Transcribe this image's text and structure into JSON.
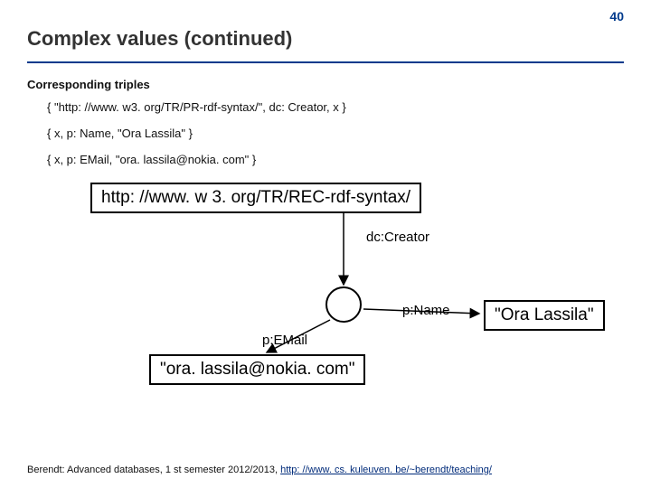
{
  "page_number": "40",
  "title": "Complex values (continued)",
  "subhead": "Corresponding triples",
  "triples": {
    "t1": "{ \"http: //www. w3. org/TR/PR-rdf-syntax/\", dc: Creator, x }",
    "t2": "{ x, p: Name, \"Ora Lassila\" }",
    "t3": "{ x, p: EMail, \"ora. lassila@nokia. com\" }"
  },
  "diagram": {
    "uri": "http: //www. w 3. org/TR/REC-rdf-syntax/",
    "creator_label": "dc:Creator",
    "name_label": "p:Name",
    "email_label": "p:EMail",
    "name_value": "\"Ora Lassila\"",
    "email_value": "\"ora. lassila@nokia. com\""
  },
  "footer": {
    "prefix": "Berendt: Advanced databases, 1 st semester 2012/2013, ",
    "link": "http: //www. cs. kuleuven. be/~berendt/teaching/"
  }
}
